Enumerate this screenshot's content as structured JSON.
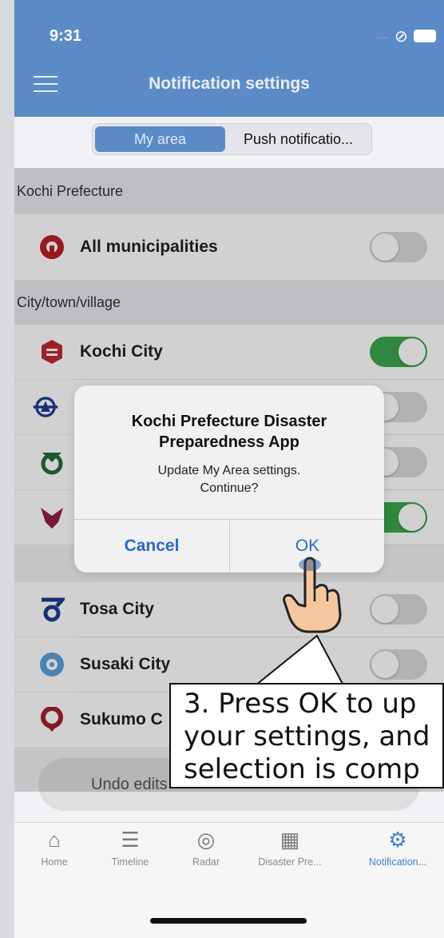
{
  "status": {
    "time": "9:31"
  },
  "header": {
    "title": "Notification settings",
    "menu_icon": "hamburger-menu-icon"
  },
  "segment": {
    "options": [
      "My area",
      "Push notificatio..."
    ],
    "selected": "My area"
  },
  "sections": {
    "prefecture": {
      "title": "Kochi Prefecture"
    },
    "city": {
      "title": "City/town/village"
    }
  },
  "rows": {
    "all": {
      "label": "All municipalities",
      "on": false
    },
    "kochi": {
      "label": "Kochi City",
      "on": true
    },
    "tosa": {
      "label": "Tosa City",
      "on": false
    },
    "susaki": {
      "label": "Susaki City",
      "on": false
    },
    "sukumo": {
      "label": "Sukumo C",
      "on": false
    }
  },
  "dialog": {
    "title": "Kochi Prefecture Disaster Preparedness App",
    "message": "Update My Area settings. Continue?",
    "cancel": "Cancel",
    "ok": "OK"
  },
  "undo_label": "Undo edits",
  "callout": {
    "text": "3. Press OK to up\nyour settings, and\nselection is comp"
  },
  "tabs": [
    {
      "label": "Home",
      "icon": "home-icon"
    },
    {
      "label": "Timeline",
      "icon": "timeline-icon"
    },
    {
      "label": "Radar",
      "icon": "radar-icon"
    },
    {
      "label": "Disaster Pre...",
      "icon": "disaster-map-icon"
    },
    {
      "label": "Notification...",
      "icon": "gear-icon",
      "active": true
    }
  ],
  "colors": {
    "header": "#5b8bc7",
    "toggle_on": "#3aa74c",
    "link": "#2b68c8"
  }
}
